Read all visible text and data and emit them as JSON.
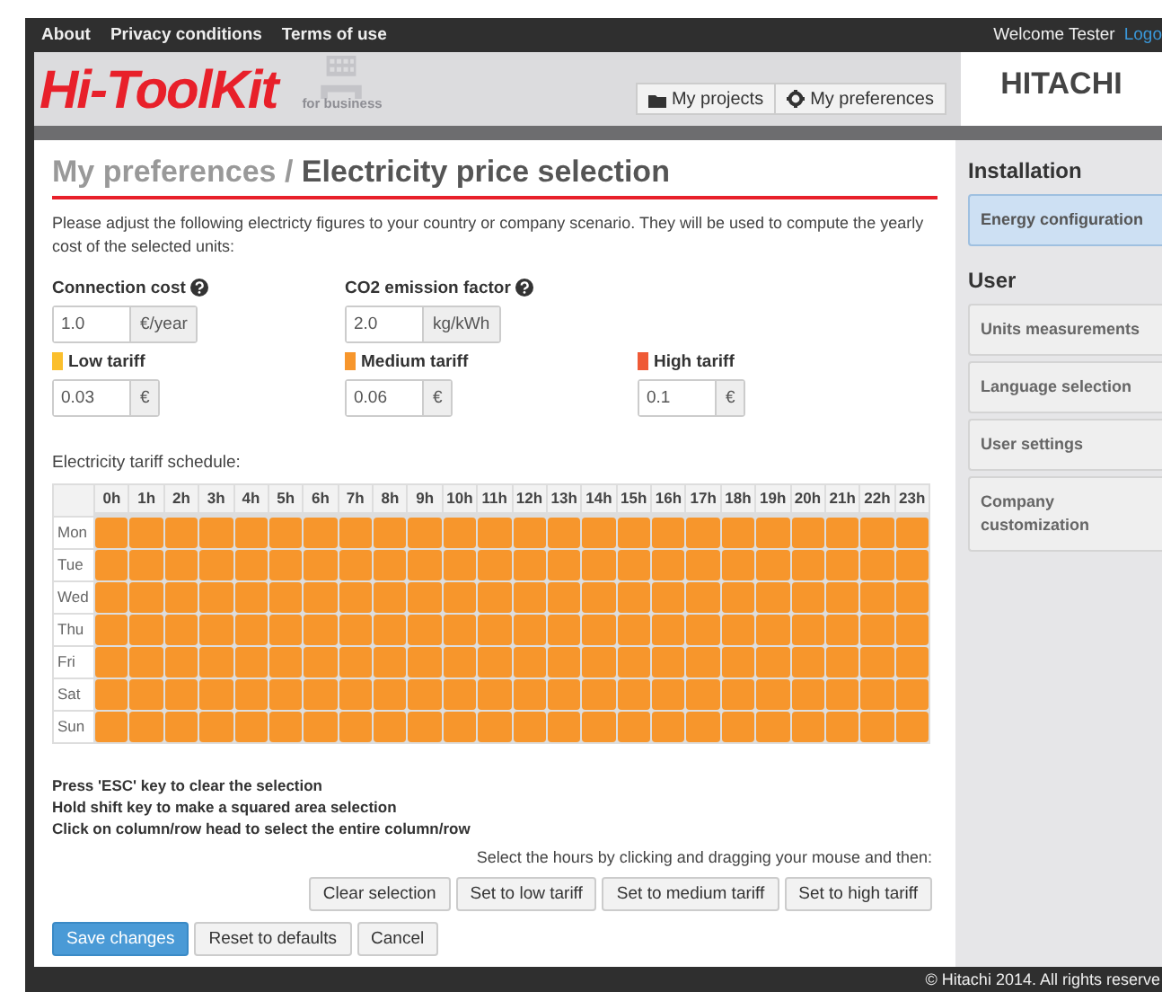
{
  "top_nav": {
    "links": [
      "About",
      "Privacy conditions",
      "Terms of use"
    ],
    "welcome": "Welcome Tester",
    "logout": "Logo"
  },
  "header": {
    "logo": "Hi-ToolKit",
    "logo_badge": "for business",
    "buttons": [
      "My projects",
      "My preferences"
    ],
    "brand": "HITACHI"
  },
  "page": {
    "breadcrumb": "My preferences /",
    "title": "Electricity price selection",
    "intro": "Please adjust the following electricty figures to your country or company scenario. They will be used to compute the yearly cost of the selected units:",
    "fields": [
      {
        "label": "Connection cost",
        "help": true,
        "value": "1.0",
        "unit": "€/year"
      },
      {
        "label": "CO2 emission factor",
        "help": true,
        "value": "2.0",
        "unit": "kg/kWh"
      }
    ],
    "tariffs": [
      {
        "kind": "low",
        "label": "Low tariff",
        "value": "0.03",
        "unit": "€",
        "color": "#fbbf2c"
      },
      {
        "kind": "medium",
        "label": "Medium tariff",
        "value": "0.06",
        "unit": "€",
        "color": "#f7962c"
      },
      {
        "kind": "high",
        "label": "High tariff",
        "value": "0.1",
        "unit": "€",
        "color": "#ef5a36"
      }
    ],
    "schedule": {
      "label": "Electricity tariff schedule:",
      "hours": [
        "0h",
        "1h",
        "2h",
        "3h",
        "4h",
        "5h",
        "6h",
        "7h",
        "8h",
        "9h",
        "10h",
        "11h",
        "12h",
        "13h",
        "14h",
        "15h",
        "16h",
        "17h",
        "18h",
        "19h",
        "20h",
        "21h",
        "22h",
        "23h"
      ],
      "rows": [
        {
          "day": "Mon",
          "cells": [
            {
              "kind": "medium"
            },
            {
              "kind": "medium"
            },
            {
              "kind": "medium"
            },
            {
              "kind": "medium"
            },
            {
              "kind": "medium"
            },
            {
              "kind": "medium"
            },
            {
              "kind": "medium"
            },
            {
              "kind": "medium"
            },
            {
              "kind": "medium"
            },
            {
              "kind": "medium"
            },
            {
              "kind": "medium"
            },
            {
              "kind": "medium"
            },
            {
              "kind": "medium"
            },
            {
              "kind": "medium"
            },
            {
              "kind": "medium"
            },
            {
              "kind": "medium"
            },
            {
              "kind": "medium"
            },
            {
              "kind": "medium"
            },
            {
              "kind": "medium"
            },
            {
              "kind": "medium"
            },
            {
              "kind": "medium"
            },
            {
              "kind": "medium"
            },
            {
              "kind": "medium"
            },
            {
              "kind": "medium"
            }
          ]
        },
        {
          "day": "Tue",
          "cells": [
            {
              "kind": "medium"
            },
            {
              "kind": "medium"
            },
            {
              "kind": "medium"
            },
            {
              "kind": "medium"
            },
            {
              "kind": "medium"
            },
            {
              "kind": "medium"
            },
            {
              "kind": "medium"
            },
            {
              "kind": "medium"
            },
            {
              "kind": "medium"
            },
            {
              "kind": "medium"
            },
            {
              "kind": "medium"
            },
            {
              "kind": "medium"
            },
            {
              "kind": "medium"
            },
            {
              "kind": "medium"
            },
            {
              "kind": "medium"
            },
            {
              "kind": "medium"
            },
            {
              "kind": "medium"
            },
            {
              "kind": "medium"
            },
            {
              "kind": "medium"
            },
            {
              "kind": "medium"
            },
            {
              "kind": "medium"
            },
            {
              "kind": "medium"
            },
            {
              "kind": "medium"
            },
            {
              "kind": "medium"
            }
          ]
        },
        {
          "day": "Wed",
          "cells": [
            {
              "kind": "medium"
            },
            {
              "kind": "medium"
            },
            {
              "kind": "medium"
            },
            {
              "kind": "medium"
            },
            {
              "kind": "medium"
            },
            {
              "kind": "medium"
            },
            {
              "kind": "medium"
            },
            {
              "kind": "medium"
            },
            {
              "kind": "medium"
            },
            {
              "kind": "medium"
            },
            {
              "kind": "medium"
            },
            {
              "kind": "medium"
            },
            {
              "kind": "medium"
            },
            {
              "kind": "medium"
            },
            {
              "kind": "medium"
            },
            {
              "kind": "medium"
            },
            {
              "kind": "medium"
            },
            {
              "kind": "medium"
            },
            {
              "kind": "medium"
            },
            {
              "kind": "medium"
            },
            {
              "kind": "medium"
            },
            {
              "kind": "medium"
            },
            {
              "kind": "medium"
            },
            {
              "kind": "medium"
            }
          ]
        },
        {
          "day": "Thu",
          "cells": [
            {
              "kind": "medium"
            },
            {
              "kind": "medium"
            },
            {
              "kind": "medium"
            },
            {
              "kind": "medium"
            },
            {
              "kind": "medium"
            },
            {
              "kind": "medium"
            },
            {
              "kind": "medium"
            },
            {
              "kind": "medium"
            },
            {
              "kind": "medium"
            },
            {
              "kind": "medium"
            },
            {
              "kind": "medium"
            },
            {
              "kind": "medium"
            },
            {
              "kind": "medium"
            },
            {
              "kind": "medium"
            },
            {
              "kind": "medium"
            },
            {
              "kind": "medium"
            },
            {
              "kind": "medium"
            },
            {
              "kind": "medium"
            },
            {
              "kind": "medium"
            },
            {
              "kind": "medium"
            },
            {
              "kind": "medium"
            },
            {
              "kind": "medium"
            },
            {
              "kind": "medium"
            },
            {
              "kind": "medium"
            }
          ]
        },
        {
          "day": "Fri",
          "cells": [
            {
              "kind": "medium"
            },
            {
              "kind": "medium"
            },
            {
              "kind": "medium"
            },
            {
              "kind": "medium"
            },
            {
              "kind": "medium"
            },
            {
              "kind": "medium"
            },
            {
              "kind": "medium"
            },
            {
              "kind": "medium"
            },
            {
              "kind": "medium"
            },
            {
              "kind": "medium"
            },
            {
              "kind": "medium"
            },
            {
              "kind": "medium"
            },
            {
              "kind": "medium"
            },
            {
              "kind": "medium"
            },
            {
              "kind": "medium"
            },
            {
              "kind": "medium"
            },
            {
              "kind": "medium"
            },
            {
              "kind": "medium"
            },
            {
              "kind": "medium"
            },
            {
              "kind": "medium"
            },
            {
              "kind": "medium"
            },
            {
              "kind": "medium"
            },
            {
              "kind": "medium"
            },
            {
              "kind": "medium"
            }
          ]
        },
        {
          "day": "Sat",
          "cells": [
            {
              "kind": "medium"
            },
            {
              "kind": "medium"
            },
            {
              "kind": "medium"
            },
            {
              "kind": "medium"
            },
            {
              "kind": "medium"
            },
            {
              "kind": "medium"
            },
            {
              "kind": "medium"
            },
            {
              "kind": "medium"
            },
            {
              "kind": "medium"
            },
            {
              "kind": "medium"
            },
            {
              "kind": "medium"
            },
            {
              "kind": "medium"
            },
            {
              "kind": "medium"
            },
            {
              "kind": "medium"
            },
            {
              "kind": "medium"
            },
            {
              "kind": "medium"
            },
            {
              "kind": "medium"
            },
            {
              "kind": "medium"
            },
            {
              "kind": "medium"
            },
            {
              "kind": "medium"
            },
            {
              "kind": "medium"
            },
            {
              "kind": "medium"
            },
            {
              "kind": "medium"
            },
            {
              "kind": "medium"
            }
          ]
        },
        {
          "day": "Sun",
          "cells": [
            {
              "kind": "medium"
            },
            {
              "kind": "medium"
            },
            {
              "kind": "medium"
            },
            {
              "kind": "medium"
            },
            {
              "kind": "medium"
            },
            {
              "kind": "medium"
            },
            {
              "kind": "medium"
            },
            {
              "kind": "medium"
            },
            {
              "kind": "medium"
            },
            {
              "kind": "medium"
            },
            {
              "kind": "medium"
            },
            {
              "kind": "medium"
            },
            {
              "kind": "medium"
            },
            {
              "kind": "medium"
            },
            {
              "kind": "medium"
            },
            {
              "kind": "medium"
            },
            {
              "kind": "medium"
            },
            {
              "kind": "medium"
            },
            {
              "kind": "medium"
            },
            {
              "kind": "medium"
            },
            {
              "kind": "medium"
            },
            {
              "kind": "medium"
            },
            {
              "kind": "medium"
            },
            {
              "kind": "medium"
            }
          ]
        }
      ]
    },
    "hints": [
      "Press 'ESC' key to clear the selection",
      "Hold shift key to make a squared area selection",
      "Click on column/row head to select the entire column/row"
    ],
    "instruction": "Select the hours by clicking and dragging your mouse and then:",
    "tariff_buttons": [
      "Clear selection",
      "Set to low tariff",
      "Set to medium tariff",
      "Set to high tariff"
    ],
    "actions": [
      {
        "label": "Save changes",
        "primary": true
      },
      {
        "label": "Reset to defaults",
        "primary": false
      },
      {
        "label": "Cancel",
        "primary": false
      }
    ]
  },
  "sidebar": {
    "sections": [
      {
        "title": "Installation",
        "items": [
          {
            "label": "Energy configuration",
            "selected": true
          }
        ]
      },
      {
        "title": "User",
        "items": [
          {
            "label": "Units measurements",
            "selected": false
          },
          {
            "label": "Language selection",
            "selected": false
          },
          {
            "label": "User settings",
            "selected": false
          },
          {
            "label": "Company customization",
            "selected": false
          }
        ]
      }
    ]
  },
  "footer": "© Hitachi 2014. All rights reserve"
}
